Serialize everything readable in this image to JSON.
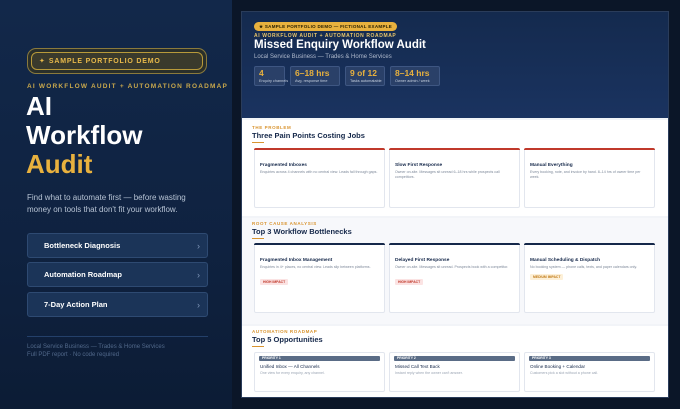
{
  "left": {
    "badge": "SAMPLE PORTFOLIO DEMO",
    "kicker": "AI WORKFLOW AUDIT + AUTOMATION ROADMAP",
    "hero_line1": "AI",
    "hero_line2": "Workflow",
    "hero_line3": "Audit",
    "description": "Find what to automate first — before wasting money on tools that don't fit your workflow.",
    "menu": [
      {
        "label": "Bottleneck Diagnosis"
      },
      {
        "label": "Automation Roadmap"
      },
      {
        "label": "7-Day Action Plan"
      }
    ],
    "footer_line1": "Local Service Business — Trades & Home Services",
    "footer_line2": "Full PDF report · No code required"
  },
  "sheet": {
    "pill": "★ SAMPLE PORTFOLIO DEMO — FICTIONAL EXAMPLE",
    "kicker": "AI WORKFLOW AUDIT + AUTOMATION ROADMAP",
    "title": "Missed Enquiry Workflow Audit",
    "subtitle": "Local Service Business — Trades & Home Services",
    "stats": [
      {
        "value": "4",
        "label": "Enquiry channels"
      },
      {
        "value": "6–18 hrs",
        "label": "Avg. response time"
      },
      {
        "value": "9 of 12",
        "label": "Tasks automatable"
      },
      {
        "value": "8–14 hrs",
        "label": "Owner admin / week"
      }
    ],
    "problem": {
      "kicker": "THE PROBLEM",
      "title": "Three Pain Points Costing Jobs",
      "cards": [
        {
          "title": "Fragmented Inboxes",
          "desc": "Enquiries across 4 channels with no central view. Leads fall through gaps."
        },
        {
          "title": "Slow First Response",
          "desc": "Owner on-site. Messages sit unread 6–18 hrs while prospects call competitors."
        },
        {
          "title": "Manual Everything",
          "desc": "Every booking, note, and invoice by hand. 8–14 hrs of owner time per week."
        }
      ]
    },
    "bottlenecks": {
      "kicker": "ROOT CAUSE ANALYSIS",
      "title": "Top 3 Workflow Bottlenecks",
      "cards": [
        {
          "title": "Fragmented Inbox Management",
          "desc": "Enquiries in 4+ places, no central view. Leads slip between platforms.",
          "tag": "HIGH IMPACT",
          "level": "high"
        },
        {
          "title": "Delayed First Response",
          "desc": "Owner on-site. Messages sit unread. Prospects book with a competitor.",
          "tag": "HIGH IMPACT",
          "level": "high"
        },
        {
          "title": "Manual Scheduling & Dispatch",
          "desc": "No booking system — phone calls, texts, and paper calendars only.",
          "tag": "MEDIUM IMPACT",
          "level": "med"
        }
      ]
    },
    "roadmap": {
      "kicker": "AUTOMATION ROADMAP",
      "title": "Top 5 Opportunities",
      "cards": [
        {
          "priority": "PRIORITY 1",
          "title": "Unified Inbox — All Channels",
          "desc": "One view for every enquiry, any channel."
        },
        {
          "priority": "PRIORITY 2",
          "title": "Missed Call Text Back",
          "desc": "Instant reply when the owner can't answer."
        },
        {
          "priority": "PRIORITY 3",
          "title": "Online Booking + Calendar",
          "desc": "Customers pick a slot without a phone call."
        }
      ]
    }
  },
  "colors": {
    "accent_gold": "#e8b13e",
    "navy": "#15284a",
    "high_impact": "#c0392b",
    "medium_impact": "#c07a17"
  }
}
